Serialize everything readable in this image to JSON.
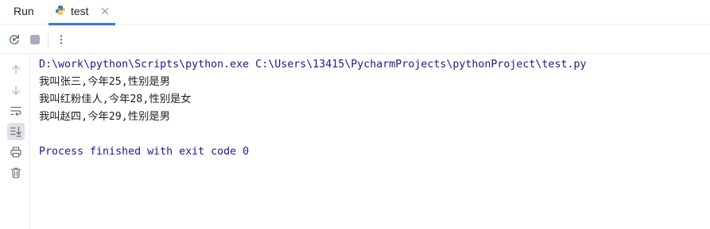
{
  "run_panel": {
    "title": "Run",
    "tab": {
      "label": "test"
    }
  },
  "console": {
    "command": "D:\\work\\python\\Scripts\\python.exe C:\\Users\\13415\\PycharmProjects\\pythonProject\\test.py",
    "output": [
      "我叫张三,今年25,性别是男",
      "我叫红粉佳人,今年28,性别是女",
      "我叫赵四,今年29,性别是男"
    ],
    "exit_message": "Process finished with exit code 0"
  },
  "colors": {
    "accent": "#3574f0",
    "command_text": "#1a1a8f",
    "rerun_green": "#208a3c"
  },
  "icons": {
    "toolbar": [
      "rerun-icon",
      "stop-icon",
      "more-options-icon"
    ],
    "gutter": [
      "up-arrow-icon",
      "down-arrow-icon",
      "soft-wrap-icon",
      "scroll-to-end-icon",
      "print-icon",
      "trash-icon"
    ]
  }
}
